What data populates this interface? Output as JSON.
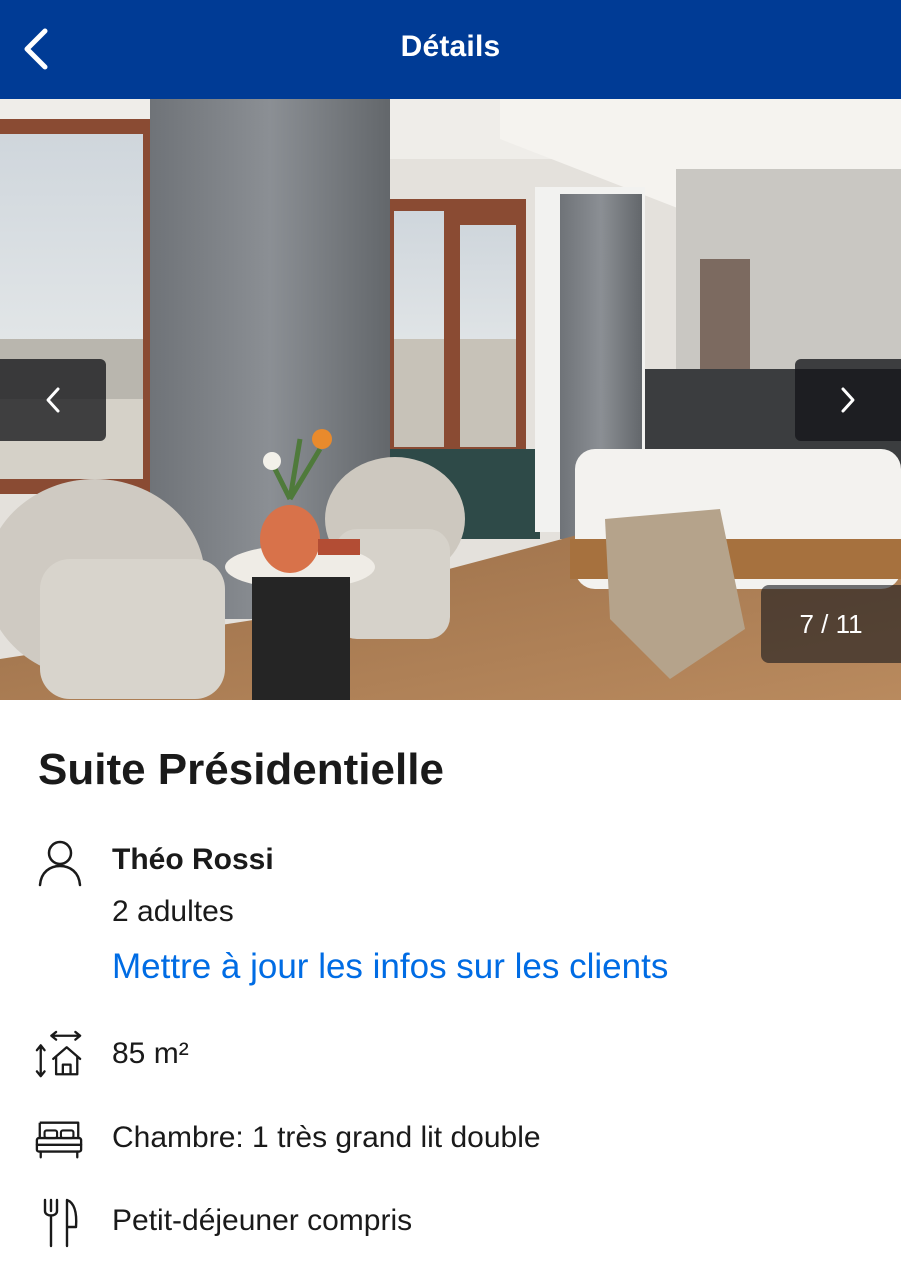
{
  "header": {
    "title": "Détails",
    "back_icon": "chevron-left-icon"
  },
  "gallery": {
    "counter": "7 / 11",
    "prev_icon": "chevron-left-icon",
    "next_icon": "chevron-right-icon"
  },
  "room": {
    "title": "Suite Présidentielle"
  },
  "guest": {
    "icon": "person-icon",
    "name": "Théo Rossi",
    "count": "2 adultes",
    "update_link": "Mettre à jour les infos sur les clients"
  },
  "features": {
    "size": {
      "icon": "room-size-icon",
      "label": "85 m²"
    },
    "bed": {
      "icon": "bed-icon",
      "label": "Chambre: 1 très grand lit double"
    },
    "meal": {
      "icon": "fork-knife-icon",
      "label": "Petit-déjeuner compris"
    }
  },
  "colors": {
    "header_bg": "#003b95",
    "link": "#006ce4",
    "text": "#1a1a1a"
  }
}
